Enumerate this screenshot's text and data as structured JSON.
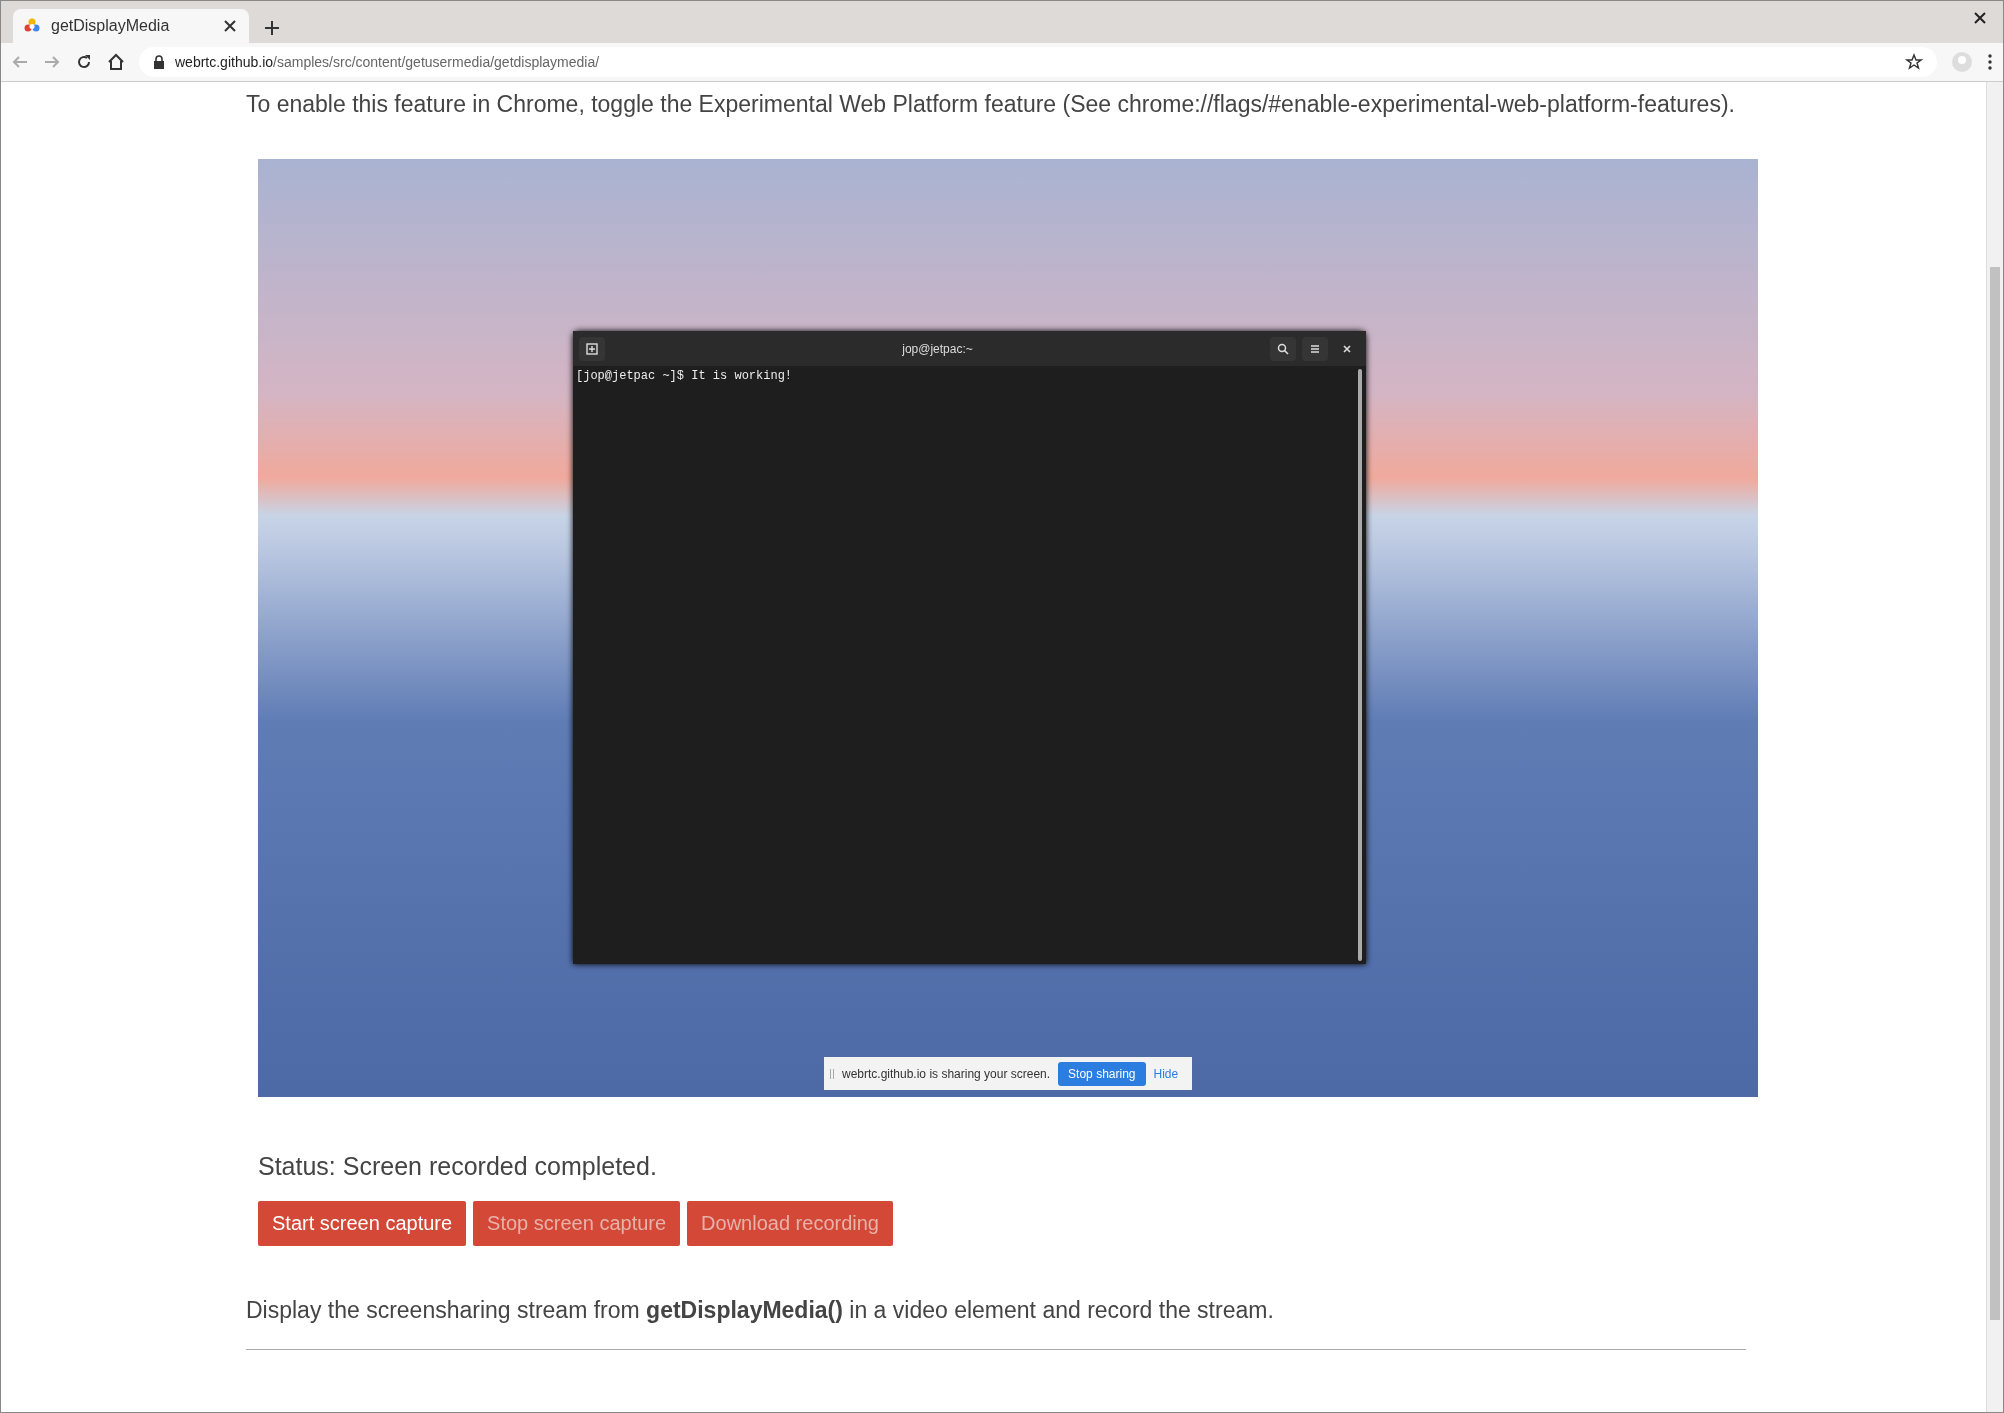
{
  "browser": {
    "tabs": [
      {
        "title": "getDisplayMedia",
        "selected": true
      }
    ],
    "address": {
      "host": "webrtc.github.io",
      "path": "/samples/src/content/getusermedia/getdisplaymedia/"
    }
  },
  "intro": "To enable this feature in Chrome, toggle the Experimental Web Platform feature (See chrome://flags/#enable-experimental-web-platform-features).",
  "video": {
    "terminal": {
      "title": "jop@jetpac:~",
      "lines": [
        "[jop@jetpac ~]$ It is working!"
      ]
    },
    "share_bar": {
      "message": "webrtc.github.io is sharing your screen.",
      "stop": "Stop sharing",
      "hide": "Hide"
    }
  },
  "status": "Status: Screen recorded completed.",
  "buttons": [
    {
      "label": "Start screen capture",
      "disabled": false
    },
    {
      "label": "Stop screen capture",
      "disabled": true
    },
    {
      "label": "Download recording",
      "disabled": true
    }
  ],
  "description": "Display the screensharing stream from **getDisplayMedia()** in a video element and record the stream."
}
